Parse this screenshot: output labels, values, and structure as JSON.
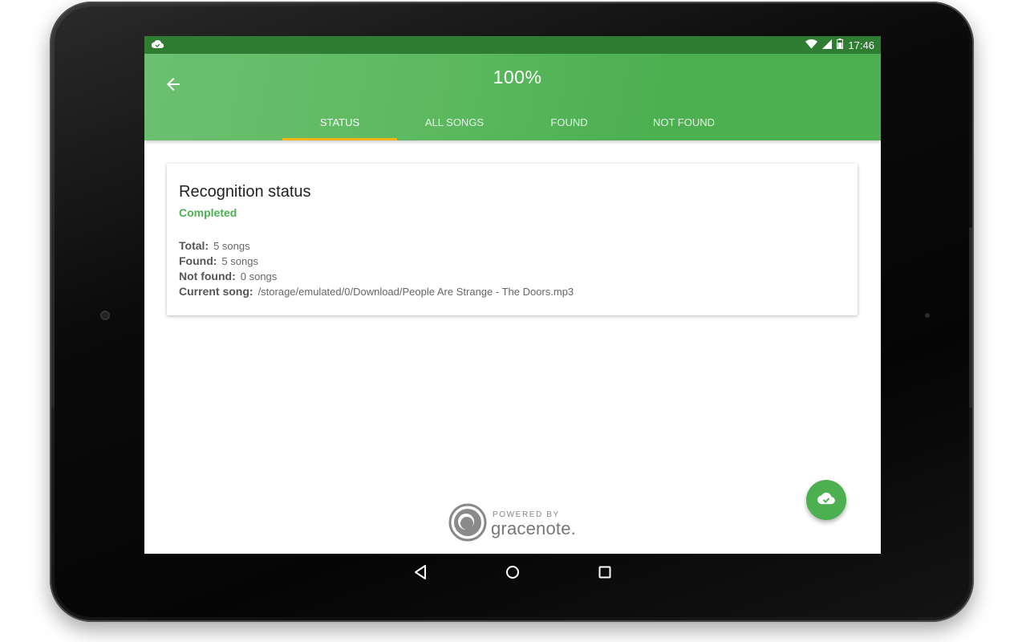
{
  "statusbar": {
    "time": "17:46",
    "left_icon": "cloud-done-icon",
    "icons": [
      "wifi-icon",
      "signal-icon",
      "battery-icon"
    ]
  },
  "appbar": {
    "title": "100%",
    "back_icon": "arrow-back-icon",
    "tabs": [
      {
        "label": "STATUS",
        "active": true
      },
      {
        "label": "ALL SONGS",
        "active": false
      },
      {
        "label": "FOUND",
        "active": false
      },
      {
        "label": "NOT FOUND",
        "active": false
      }
    ]
  },
  "card": {
    "title": "Recognition status",
    "status": "Completed",
    "rows": [
      {
        "key": "Total:",
        "value": "5 songs"
      },
      {
        "key": "Found:",
        "value": "5 songs"
      },
      {
        "key": "Not found:",
        "value": "0 songs"
      },
      {
        "key": "Current song:",
        "value": "/storage/emulated/0/Download/People Are Strange - The Doors.mp3"
      }
    ]
  },
  "branding": {
    "powered_by": "POWERED BY",
    "name": "gracenote."
  },
  "fab": {
    "icon": "cloud-done-icon"
  },
  "navbar": {
    "icons": [
      "nav-back-icon",
      "nav-home-icon",
      "nav-recents-icon"
    ]
  },
  "colors": {
    "primary": "#4caf50",
    "primary_dark": "#2e7d32",
    "tab_indicator": "#f5b41a"
  }
}
